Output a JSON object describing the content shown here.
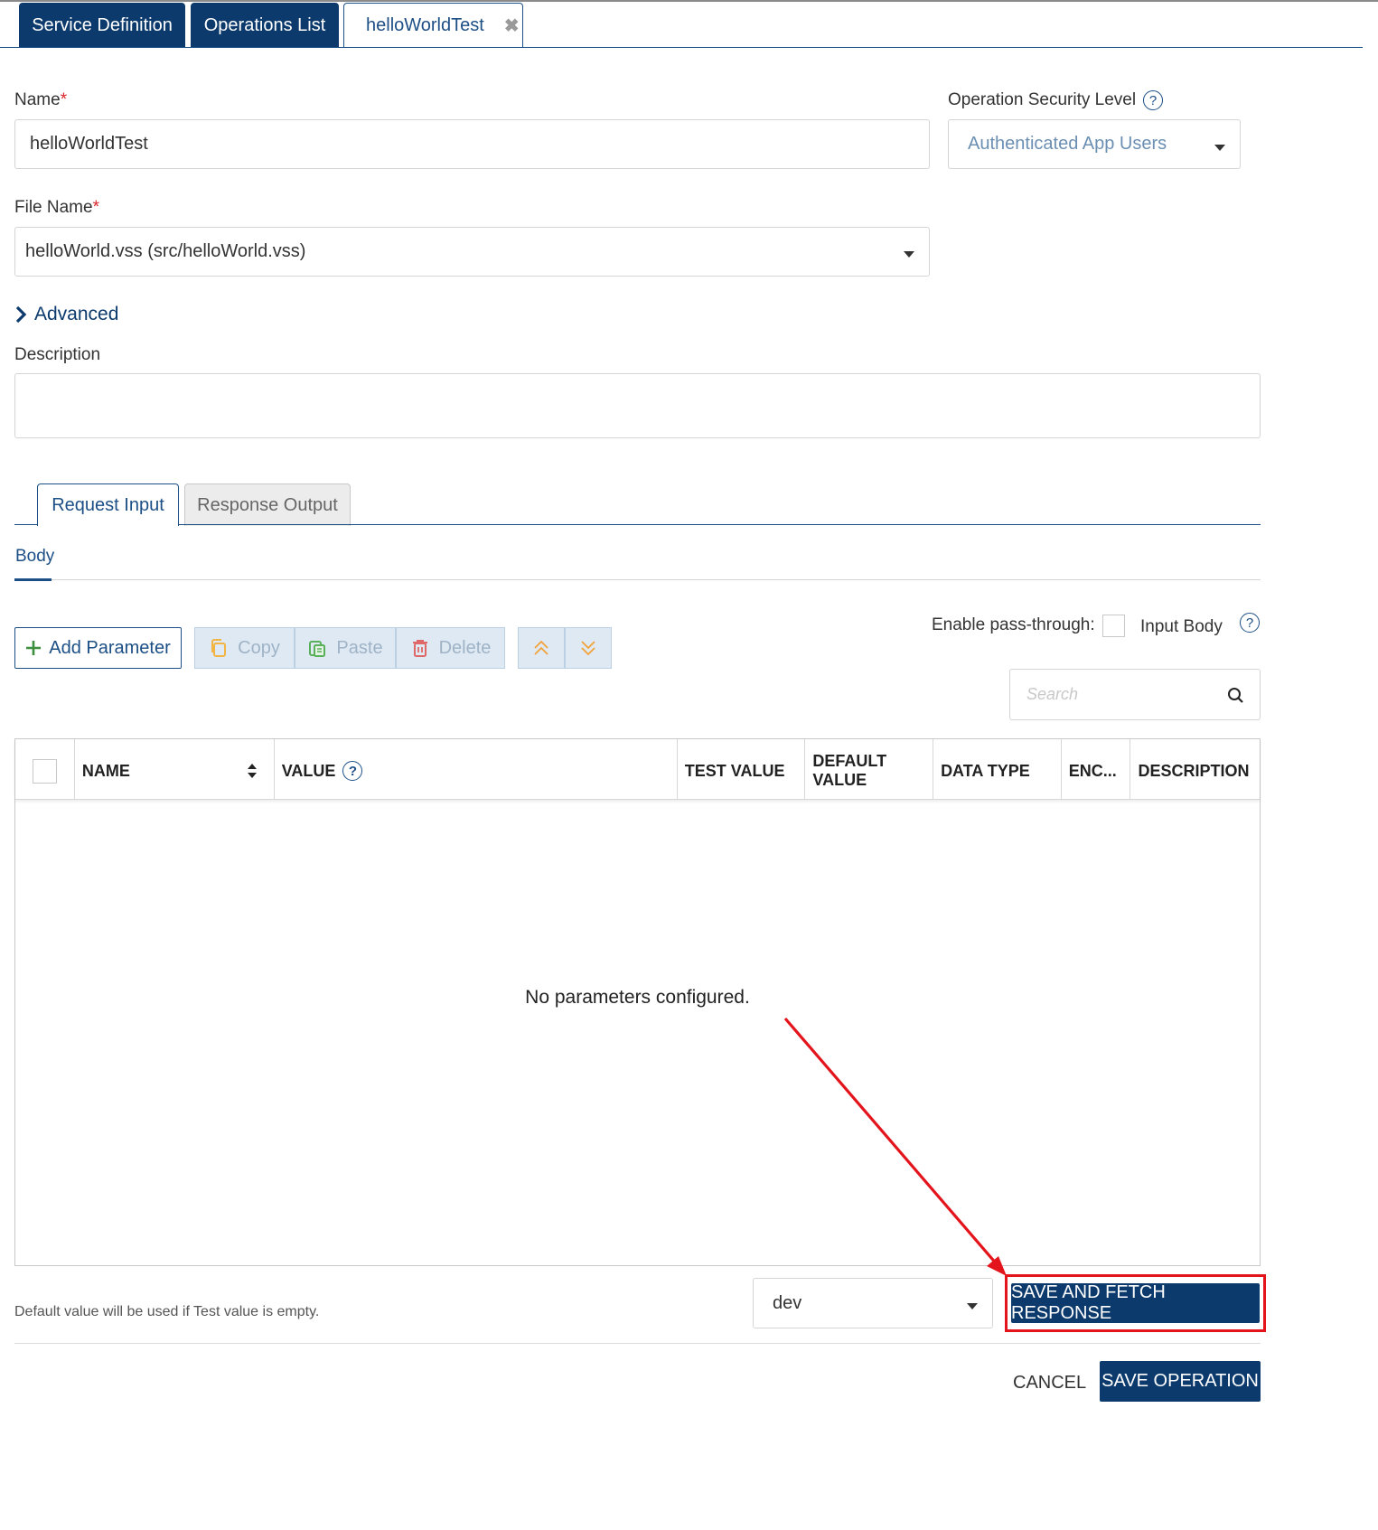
{
  "tabs": {
    "service_definition": "Service Definition",
    "operations_list": "Operations List",
    "active": "helloWorldTest",
    "close_glyph": "✖"
  },
  "form": {
    "name_label": "Name",
    "required_mark": "*",
    "name_value": "helloWorldTest",
    "security_label": "Operation Security Level",
    "security_value": "Authenticated App Users",
    "file_label": "File Name",
    "file_value": "helloWorld.vss (src/helloWorld.vss)",
    "advanced_label": "Advanced",
    "description_label": "Description",
    "description_value": ""
  },
  "subtabs": {
    "request_input": "Request Input",
    "response_output": "Response Output",
    "body": "Body"
  },
  "toolbar": {
    "add_parameter": "Add Parameter",
    "copy": "Copy",
    "paste": "Paste",
    "delete": "Delete",
    "pass_through_label": "Enable pass-through:",
    "input_body": "Input Body",
    "search_placeholder": "Search"
  },
  "table": {
    "columns": [
      "NAME",
      "VALUE",
      "TEST VALUE",
      "DEFAULT VALUE",
      "DATA TYPE",
      "ENC...",
      "DESCRIPTION"
    ],
    "empty_message": "No parameters configured."
  },
  "footer": {
    "hint": "Default value will be used if Test value is empty.",
    "environment": "dev",
    "save_fetch": "SAVE AND FETCH RESPONSE",
    "cancel": "CANCEL",
    "save_operation": "SAVE OPERATION"
  },
  "colors": {
    "primary": "#0c3a6c",
    "accent": "#1c4f86",
    "annotation": "#e3141b"
  },
  "icons": {
    "help": "question-circle-icon",
    "advanced": "chevron-right-icon",
    "add": "plus-icon",
    "copy": "copy-icon",
    "paste": "paste-icon",
    "delete": "trash-icon",
    "move_up": "double-chevron-up-icon",
    "move_down": "double-chevron-down-icon",
    "search": "search-icon",
    "sort": "sort-icon"
  }
}
